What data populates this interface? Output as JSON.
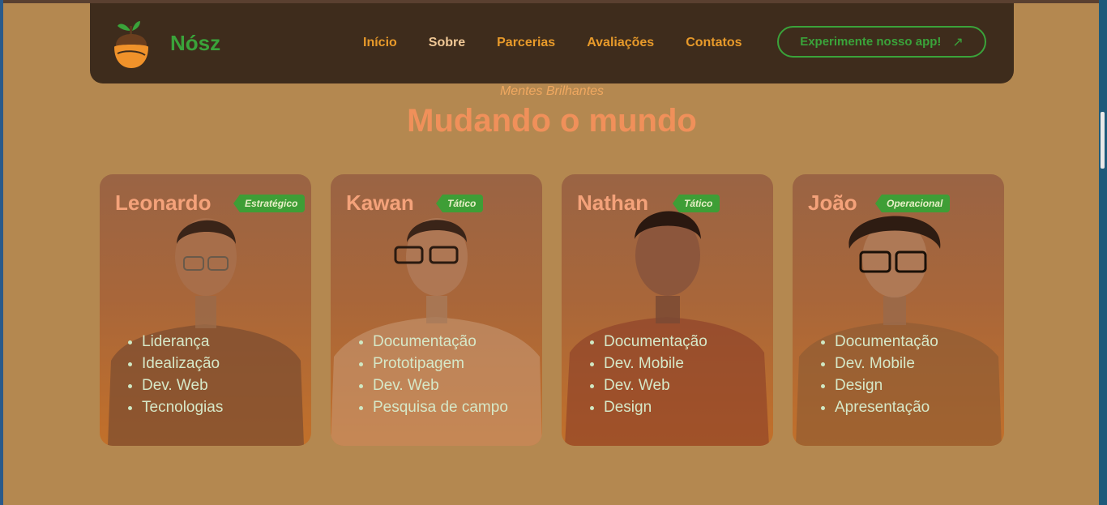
{
  "nav": {
    "brand": "Nósz",
    "links": [
      "Início",
      "Sobre",
      "Parcerias",
      "Avaliações",
      "Contatos"
    ],
    "active": "Sobre",
    "cta_label": "Experimente nosso app!",
    "cta_icon": "arrow-up-right-icon"
  },
  "section": {
    "subtitle": "Mentes Brilhantes",
    "title": "Mudando o mundo"
  },
  "team": [
    {
      "name": "Leonardo",
      "role": "Estratégico",
      "skills": [
        "Liderança",
        "Idealização",
        "Dev. Web",
        "Tecnologias"
      ]
    },
    {
      "name": "Kawan",
      "role": "Tático",
      "skills": [
        "Documentação",
        "Prototipagem",
        "Dev. Web",
        "Pesquisa de campo"
      ]
    },
    {
      "name": "Nathan",
      "role": "Tático",
      "skills": [
        "Documentação",
        "Dev. Mobile",
        "Dev. Web",
        "Design"
      ]
    },
    {
      "name": "João",
      "role": "Operacional",
      "skills": [
        "Documentação",
        "Dev. Mobile",
        "Design",
        "Apresentação"
      ]
    }
  ],
  "colors": {
    "page_bg": "#b48850",
    "nav_bg": "#3e2c1c",
    "accent_green": "#3aa33a",
    "nav_link": "#e89a2a",
    "title": "#f0905a"
  }
}
